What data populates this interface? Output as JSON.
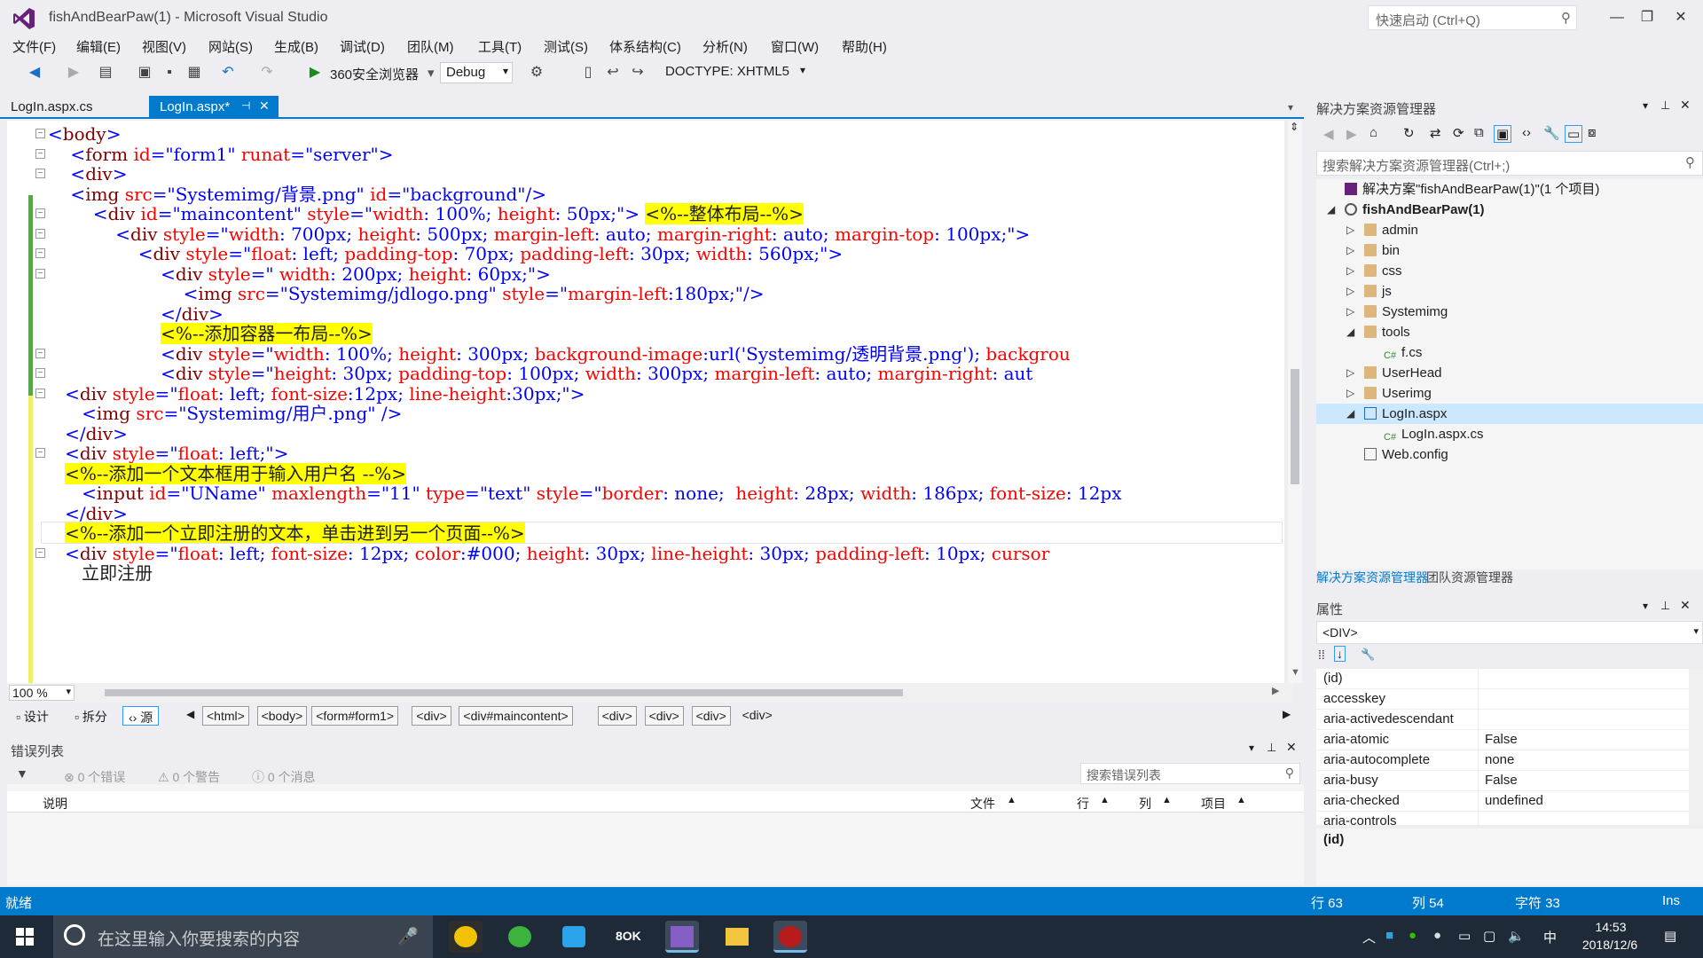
{
  "window": {
    "title": "fishAndBearPaw(1) - Microsoft Visual Studio",
    "quick_launch_placeholder": "快速启动 (Ctrl+Q)",
    "minimize": "—",
    "restore": "❐",
    "close": "✕"
  },
  "menu": [
    "文件(F)",
    "编辑(E)",
    "视图(V)",
    "网站(S)",
    "生成(B)",
    "调试(D)",
    "团队(M)",
    "工具(T)",
    "测试(S)",
    "体系结构(C)",
    "分析(N)",
    "窗口(W)",
    "帮助(H)"
  ],
  "toolbar": {
    "browser": "360安全浏览器",
    "config": "Debug",
    "doctype": "DOCTYPE: XHTML5"
  },
  "doc_tabs": [
    {
      "label": "LogIn.aspx.cs",
      "active": false
    },
    {
      "label": "LogIn.aspx*",
      "active": true
    }
  ],
  "code_lines": [
    [
      {
        "t": "br",
        "s": "<"
      },
      {
        "t": "tag",
        "s": "body"
      },
      {
        "t": "br",
        "s": ">"
      }
    ],
    [
      {
        "t": "br",
        "s": "    <"
      },
      {
        "t": "tag",
        "s": "form"
      },
      {
        "t": "attr",
        "s": " id"
      },
      {
        "t": "br",
        "s": "="
      },
      {
        "t": "val",
        "s": "\"form1\""
      },
      {
        "t": "attr",
        "s": " runat"
      },
      {
        "t": "br",
        "s": "="
      },
      {
        "t": "val",
        "s": "\"server\""
      },
      {
        "t": "br",
        "s": ">"
      }
    ],
    [
      {
        "t": "br",
        "s": "    <"
      },
      {
        "t": "tag",
        "s": "div"
      },
      {
        "t": "br",
        "s": ">"
      }
    ],
    [
      {
        "t": "br",
        "s": "    <"
      },
      {
        "t": "tag",
        "s": "img"
      },
      {
        "t": "attr",
        "s": " src"
      },
      {
        "t": "br",
        "s": "="
      },
      {
        "t": "val",
        "s": "\"Systemimg/背景.png\""
      },
      {
        "t": "attr",
        "s": " id"
      },
      {
        "t": "br",
        "s": "="
      },
      {
        "t": "val",
        "s": "\"background\""
      },
      {
        "t": "br",
        "s": "/>"
      }
    ],
    [
      {
        "t": "br",
        "s": "        <"
      },
      {
        "t": "tag",
        "s": "div"
      },
      {
        "t": "attr",
        "s": " id"
      },
      {
        "t": "br",
        "s": "="
      },
      {
        "t": "val",
        "s": "\"maincontent\""
      },
      {
        "t": "attr",
        "s": " style"
      },
      {
        "t": "br",
        "s": "="
      },
      {
        "t": "val",
        "s": "\""
      },
      {
        "t": "attr",
        "s": "width"
      },
      {
        "t": "br",
        "s": ": "
      },
      {
        "t": "val",
        "s": "100%"
      },
      {
        "t": "br",
        "s": "; "
      },
      {
        "t": "attr",
        "s": "height"
      },
      {
        "t": "br",
        "s": ": "
      },
      {
        "t": "val",
        "s": "50px"
      },
      {
        "t": "br",
        "s": ";\">"
      },
      {
        "t": "txt",
        "s": " "
      },
      {
        "t": "aspx",
        "s": "<%--整体布局--%>"
      }
    ],
    [
      {
        "t": "br",
        "s": "            <"
      },
      {
        "t": "tag",
        "s": "div"
      },
      {
        "t": "attr",
        "s": " style"
      },
      {
        "t": "br",
        "s": "="
      },
      {
        "t": "val",
        "s": "\""
      },
      {
        "t": "attr",
        "s": "width"
      },
      {
        "t": "br",
        "s": ": "
      },
      {
        "t": "val",
        "s": "700px"
      },
      {
        "t": "br",
        "s": "; "
      },
      {
        "t": "attr",
        "s": "height"
      },
      {
        "t": "br",
        "s": ": "
      },
      {
        "t": "val",
        "s": "500px"
      },
      {
        "t": "br",
        "s": "; "
      },
      {
        "t": "attr",
        "s": "margin-left"
      },
      {
        "t": "br",
        "s": ": "
      },
      {
        "t": "val",
        "s": "auto"
      },
      {
        "t": "br",
        "s": "; "
      },
      {
        "t": "attr",
        "s": "margin-right"
      },
      {
        "t": "br",
        "s": ": "
      },
      {
        "t": "val",
        "s": "auto"
      },
      {
        "t": "br",
        "s": "; "
      },
      {
        "t": "attr",
        "s": "margin-top"
      },
      {
        "t": "br",
        "s": ": "
      },
      {
        "t": "val",
        "s": "100px"
      },
      {
        "t": "br",
        "s": ";\">"
      }
    ],
    [
      {
        "t": "br",
        "s": "                <"
      },
      {
        "t": "tag",
        "s": "div"
      },
      {
        "t": "attr",
        "s": " style"
      },
      {
        "t": "br",
        "s": "="
      },
      {
        "t": "val",
        "s": "\""
      },
      {
        "t": "attr",
        "s": "float"
      },
      {
        "t": "br",
        "s": ": "
      },
      {
        "t": "val",
        "s": "left"
      },
      {
        "t": "br",
        "s": "; "
      },
      {
        "t": "attr",
        "s": "padding-top"
      },
      {
        "t": "br",
        "s": ": "
      },
      {
        "t": "val",
        "s": "70px"
      },
      {
        "t": "br",
        "s": "; "
      },
      {
        "t": "attr",
        "s": "padding-left"
      },
      {
        "t": "br",
        "s": ": "
      },
      {
        "t": "val",
        "s": "30px"
      },
      {
        "t": "br",
        "s": "; "
      },
      {
        "t": "attr",
        "s": "width"
      },
      {
        "t": "br",
        "s": ": "
      },
      {
        "t": "val",
        "s": "560px"
      },
      {
        "t": "br",
        "s": ";\">"
      }
    ],
    [
      {
        "t": "br",
        "s": "                    <"
      },
      {
        "t": "tag",
        "s": "div"
      },
      {
        "t": "attr",
        "s": " style"
      },
      {
        "t": "br",
        "s": "="
      },
      {
        "t": "val",
        "s": "\""
      },
      {
        "t": "attr",
        "s": " width"
      },
      {
        "t": "br",
        "s": ": "
      },
      {
        "t": "val",
        "s": "200px"
      },
      {
        "t": "br",
        "s": "; "
      },
      {
        "t": "attr",
        "s": "height"
      },
      {
        "t": "br",
        "s": ": "
      },
      {
        "t": "val",
        "s": "60px"
      },
      {
        "t": "br",
        "s": ";\">"
      }
    ],
    [
      {
        "t": "br",
        "s": "                        <"
      },
      {
        "t": "tag",
        "s": "img"
      },
      {
        "t": "attr",
        "s": " src"
      },
      {
        "t": "br",
        "s": "="
      },
      {
        "t": "val",
        "s": "\"Systemimg/jdlogo.png\""
      },
      {
        "t": "attr",
        "s": " style"
      },
      {
        "t": "br",
        "s": "="
      },
      {
        "t": "val",
        "s": "\""
      },
      {
        "t": "attr",
        "s": "margin-left"
      },
      {
        "t": "br",
        "s": ":"
      },
      {
        "t": "val",
        "s": "180px"
      },
      {
        "t": "br",
        "s": ";\"/>"
      }
    ],
    [
      {
        "t": "br",
        "s": "                    </"
      },
      {
        "t": "tag",
        "s": "div"
      },
      {
        "t": "br",
        "s": ">"
      }
    ],
    [
      {
        "t": "txt",
        "s": "                    "
      },
      {
        "t": "aspx",
        "s": "<%--添加容器一布局--%>"
      }
    ],
    [
      {
        "t": "br",
        "s": "                    <"
      },
      {
        "t": "tag",
        "s": "div"
      },
      {
        "t": "attr",
        "s": " style"
      },
      {
        "t": "br",
        "s": "="
      },
      {
        "t": "val",
        "s": "\""
      },
      {
        "t": "attr",
        "s": "width"
      },
      {
        "t": "br",
        "s": ": "
      },
      {
        "t": "val",
        "s": "100%"
      },
      {
        "t": "br",
        "s": "; "
      },
      {
        "t": "attr",
        "s": "height"
      },
      {
        "t": "br",
        "s": ": "
      },
      {
        "t": "val",
        "s": "300px"
      },
      {
        "t": "br",
        "s": "; "
      },
      {
        "t": "attr",
        "s": "background-image"
      },
      {
        "t": "br",
        "s": ":"
      },
      {
        "t": "val",
        "s": "url('Systemimg/透明背景.png')"
      },
      {
        "t": "br",
        "s": "; "
      },
      {
        "t": "attr",
        "s": "backgrou"
      }
    ],
    [
      {
        "t": "br",
        "s": "                    <"
      },
      {
        "t": "tag",
        "s": "div"
      },
      {
        "t": "attr",
        "s": " style"
      },
      {
        "t": "br",
        "s": "="
      },
      {
        "t": "val",
        "s": "\""
      },
      {
        "t": "attr",
        "s": "height"
      },
      {
        "t": "br",
        "s": ": "
      },
      {
        "t": "val",
        "s": "30px"
      },
      {
        "t": "br",
        "s": "; "
      },
      {
        "t": "attr",
        "s": "padding-top"
      },
      {
        "t": "br",
        "s": ": "
      },
      {
        "t": "val",
        "s": "100px"
      },
      {
        "t": "br",
        "s": "; "
      },
      {
        "t": "attr",
        "s": "width"
      },
      {
        "t": "br",
        "s": ": "
      },
      {
        "t": "val",
        "s": "300px"
      },
      {
        "t": "br",
        "s": "; "
      },
      {
        "t": "attr",
        "s": "margin-left"
      },
      {
        "t": "br",
        "s": ": "
      },
      {
        "t": "val",
        "s": "auto"
      },
      {
        "t": "br",
        "s": "; "
      },
      {
        "t": "attr",
        "s": "margin-right"
      },
      {
        "t": "br",
        "s": ": "
      },
      {
        "t": "val",
        "s": "aut"
      }
    ],
    [
      {
        "t": "br",
        "s": "   <"
      },
      {
        "t": "tag",
        "s": "div"
      },
      {
        "t": "attr",
        "s": " style"
      },
      {
        "t": "br",
        "s": "="
      },
      {
        "t": "val",
        "s": "\""
      },
      {
        "t": "attr",
        "s": "float"
      },
      {
        "t": "br",
        "s": ": "
      },
      {
        "t": "val",
        "s": "left"
      },
      {
        "t": "br",
        "s": "; "
      },
      {
        "t": "attr",
        "s": "font-size"
      },
      {
        "t": "br",
        "s": ":"
      },
      {
        "t": "val",
        "s": "12px"
      },
      {
        "t": "br",
        "s": "; "
      },
      {
        "t": "attr",
        "s": "line-height"
      },
      {
        "t": "br",
        "s": ":"
      },
      {
        "t": "val",
        "s": "30px"
      },
      {
        "t": "br",
        "s": ";\">"
      }
    ],
    [
      {
        "t": "br",
        "s": "      <"
      },
      {
        "t": "tag",
        "s": "img"
      },
      {
        "t": "attr",
        "s": " src"
      },
      {
        "t": "br",
        "s": "="
      },
      {
        "t": "val",
        "s": "\"Systemimg/用户.png\""
      },
      {
        "t": "br",
        "s": " />"
      }
    ],
    [
      {
        "t": "br",
        "s": "   </"
      },
      {
        "t": "tag",
        "s": "div"
      },
      {
        "t": "br",
        "s": ">"
      }
    ],
    [
      {
        "t": "br",
        "s": "   <"
      },
      {
        "t": "tag",
        "s": "div"
      },
      {
        "t": "attr",
        "s": " style"
      },
      {
        "t": "br",
        "s": "="
      },
      {
        "t": "val",
        "s": "\""
      },
      {
        "t": "attr",
        "s": "float"
      },
      {
        "t": "br",
        "s": ": "
      },
      {
        "t": "val",
        "s": "left"
      },
      {
        "t": "br",
        "s": ";\">"
      }
    ],
    [
      {
        "t": "txt",
        "s": "   "
      },
      {
        "t": "aspx",
        "s": "<%--添加一个文本框用于输入用户名 --%>"
      }
    ],
    [
      {
        "t": "br",
        "s": "      <"
      },
      {
        "t": "tag",
        "s": "input"
      },
      {
        "t": "attr",
        "s": " id"
      },
      {
        "t": "br",
        "s": "="
      },
      {
        "t": "val",
        "s": "\"UName\""
      },
      {
        "t": "attr",
        "s": " maxlength"
      },
      {
        "t": "br",
        "s": "="
      },
      {
        "t": "val",
        "s": "\"11\""
      },
      {
        "t": "attr",
        "s": " type"
      },
      {
        "t": "br",
        "s": "="
      },
      {
        "t": "val",
        "s": "\"text\""
      },
      {
        "t": "attr",
        "s": " style"
      },
      {
        "t": "br",
        "s": "="
      },
      {
        "t": "val",
        "s": "\""
      },
      {
        "t": "attr",
        "s": "border"
      },
      {
        "t": "br",
        "s": ": "
      },
      {
        "t": "val",
        "s": "none"
      },
      {
        "t": "br",
        "s": ";  "
      },
      {
        "t": "attr",
        "s": "height"
      },
      {
        "t": "br",
        "s": ": "
      },
      {
        "t": "val",
        "s": "28px"
      },
      {
        "t": "br",
        "s": "; "
      },
      {
        "t": "attr",
        "s": "width"
      },
      {
        "t": "br",
        "s": ": "
      },
      {
        "t": "val",
        "s": "186px"
      },
      {
        "t": "br",
        "s": "; "
      },
      {
        "t": "attr",
        "s": "font-size"
      },
      {
        "t": "br",
        "s": ": "
      },
      {
        "t": "val",
        "s": "12px"
      }
    ],
    [
      {
        "t": "br",
        "s": "   </"
      },
      {
        "t": "tag",
        "s": "div"
      },
      {
        "t": "br",
        "s": ">"
      }
    ],
    [
      {
        "t": "txt",
        "s": "   "
      },
      {
        "t": "aspx",
        "s": "<%--添加一个立即注册的文本，单击进到另一个页面--%>"
      }
    ],
    [
      {
        "t": "br",
        "s": "   <"
      },
      {
        "t": "tag",
        "s": "div"
      },
      {
        "t": "attr",
        "s": " style"
      },
      {
        "t": "br",
        "s": "="
      },
      {
        "t": "val",
        "s": "\""
      },
      {
        "t": "attr",
        "s": "float"
      },
      {
        "t": "br",
        "s": ": "
      },
      {
        "t": "val",
        "s": "left"
      },
      {
        "t": "br",
        "s": "; "
      },
      {
        "t": "attr",
        "s": "font-size"
      },
      {
        "t": "br",
        "s": ": "
      },
      {
        "t": "val",
        "s": "12px"
      },
      {
        "t": "br",
        "s": "; "
      },
      {
        "t": "attr",
        "s": "color"
      },
      {
        "t": "br",
        "s": ":"
      },
      {
        "t": "val",
        "s": "#000"
      },
      {
        "t": "br",
        "s": "; "
      },
      {
        "t": "attr",
        "s": "height"
      },
      {
        "t": "br",
        "s": ": "
      },
      {
        "t": "val",
        "s": "30px"
      },
      {
        "t": "br",
        "s": "; "
      },
      {
        "t": "attr",
        "s": "line-height"
      },
      {
        "t": "br",
        "s": ": "
      },
      {
        "t": "val",
        "s": "30px"
      },
      {
        "t": "br",
        "s": "; "
      },
      {
        "t": "attr",
        "s": "padding-left"
      },
      {
        "t": "br",
        "s": ": "
      },
      {
        "t": "val",
        "s": "10px"
      },
      {
        "t": "br",
        "s": "; "
      },
      {
        "t": "attr",
        "s": "cursor"
      }
    ],
    [
      {
        "t": "txt",
        "s": "      立即注册"
      }
    ]
  ],
  "editor": {
    "zoom": "100 %"
  },
  "designer": {
    "design": "设计",
    "split": "拆分",
    "source": "源",
    "breadcrumbs": [
      "<html>",
      "<body>",
      "<form#form1>",
      "<div>",
      "<div#maincontent>",
      "<div>",
      "<div>",
      "<div>",
      "<div>"
    ]
  },
  "error_list": {
    "title": "错误列表",
    "errors": "0 个错误",
    "warnings": "0 个警告",
    "messages": "0 个消息",
    "search_placeholder": "搜索错误列表",
    "columns": {
      "desc": "说明",
      "file": "文件",
      "line": "行",
      "col": "列",
      "project": "项目"
    }
  },
  "solution_explorer": {
    "title": "解决方案资源管理器",
    "search_placeholder": "搜索解决方案资源管理器(Ctrl+;)",
    "items": [
      {
        "label": "解决方案\"fishAndBearPaw(1)\"(1 个项目)",
        "depth": 0,
        "expander": "",
        "kind": "solution"
      },
      {
        "label": "fishAndBearPaw(1)",
        "depth": 0,
        "expander": "◢",
        "kind": "project"
      },
      {
        "label": "admin",
        "depth": 1,
        "expander": "▷",
        "kind": "folder"
      },
      {
        "label": "bin",
        "depth": 1,
        "expander": "▷",
        "kind": "folder"
      },
      {
        "label": "css",
        "depth": 1,
        "expander": "▷",
        "kind": "folder"
      },
      {
        "label": "js",
        "depth": 1,
        "expander": "▷",
        "kind": "folder"
      },
      {
        "label": "Systemimg",
        "depth": 1,
        "expander": "▷",
        "kind": "folder"
      },
      {
        "label": "tools",
        "depth": 1,
        "expander": "◢",
        "kind": "folder"
      },
      {
        "label": "f.cs",
        "depth": 2,
        "expander": "",
        "kind": "cs"
      },
      {
        "label": "UserHead",
        "depth": 1,
        "expander": "▷",
        "kind": "folder"
      },
      {
        "label": "Userimg",
        "depth": 1,
        "expander": "▷",
        "kind": "folder"
      },
      {
        "label": "LogIn.aspx",
        "depth": 1,
        "expander": "◢",
        "kind": "aspx",
        "selected": true
      },
      {
        "label": "LogIn.aspx.cs",
        "depth": 2,
        "expander": "",
        "kind": "cs"
      },
      {
        "label": "Web.config",
        "depth": 1,
        "expander": "",
        "kind": "config"
      }
    ],
    "tabs": [
      "解决方案资源管理器",
      "团队资源管理器"
    ]
  },
  "properties": {
    "title": "属性",
    "selected_object": "<DIV>",
    "rows": [
      {
        "name": "(id)",
        "value": ""
      },
      {
        "name": "accesskey",
        "value": ""
      },
      {
        "name": "aria-activedescendant",
        "value": ""
      },
      {
        "name": "aria-atomic",
        "value": "False"
      },
      {
        "name": "aria-autocomplete",
        "value": "none"
      },
      {
        "name": "aria-busy",
        "value": "False"
      },
      {
        "name": "aria-checked",
        "value": "undefined"
      },
      {
        "name": "aria-controls",
        "value": ""
      }
    ],
    "description": "(id)"
  },
  "status": {
    "ready": "就绪",
    "line": "行 63",
    "col": "列 54",
    "char": "字符 33",
    "mode": "Ins"
  },
  "taskbar": {
    "search_placeholder": "在这里输入你要搜索的内容",
    "ime": "中",
    "time": "14:53",
    "date": "2018/12/6"
  },
  "colors": {
    "accent": "#007acc",
    "aspx_highlight": "#ffff00",
    "tag": "#800000",
    "attr": "#ff0000",
    "value": "#0000ff"
  }
}
